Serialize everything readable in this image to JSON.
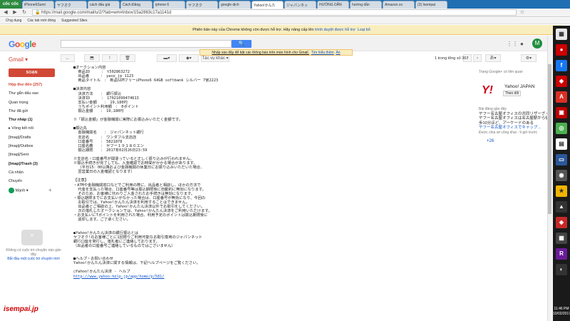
{
  "browser": {
    "logo": "cốc cốc",
    "tabs": [
      "iPhone6Sumi",
      "ヤフオク",
      "cách đấu giá",
      "Cách Đăng",
      "iphone 6",
      "ヤフオク",
      "google dịch",
      "Yahoo!かんた",
      "ジャパンネッ",
      "HƯỚNG DẪN",
      "hướng dẫn",
      "Amazon.co",
      "(3) Isempai"
    ],
    "active_tab": 7,
    "url": "https://mail.google.com/mail/u/2/?tab=wm#inbox/15a2863c17a1141d",
    "bookmarks": [
      "Ứng dụng",
      "Các tab mới đóng",
      "Suggested Sites"
    ]
  },
  "chrome_notice": {
    "text": "Phiên bản này của Chrome không còn được hỗ trợ. Hãy nâng cấp lên ",
    "link": "trình duyệt được hỗ trợ",
    "dismiss": "Loại bỏ"
  },
  "gmail": {
    "logo": "Google",
    "label": "Gmail ▾",
    "avatar": "M",
    "notice_text": "Nhấp vào đây để bật các thông báo trên màn hình cho Gmail.",
    "notice_learn": "Tìm hiểu thêm",
    "notice_hide": "Ẩn",
    "more_label": "Tác vụ khác ▾",
    "page_count": "1 trong tổng số 367",
    "compose": "SOẠN",
    "sidebar": [
      {
        "label": "Hộp thư đến (257)",
        "style": "red"
      },
      {
        "label": "Thư gắn dấu sao",
        "style": ""
      },
      {
        "label": "Quan trọng",
        "style": ""
      },
      {
        "label": "Thư đã gửi",
        "style": ""
      },
      {
        "label": "Thư nháp (1)",
        "style": "bold"
      },
      {
        "label": "▸ Vòng kết nối",
        "style": ""
      },
      {
        "label": "[Imap]/Drafts",
        "style": ""
      },
      {
        "label": "[Imap]/Outbox",
        "style": ""
      },
      {
        "label": "[Imap]/Sent",
        "style": ""
      },
      {
        "label": "[Imap]/Trash (3)",
        "style": "bold"
      },
      {
        "label": "Cá nhân",
        "style": ""
      },
      {
        "label": "Chuyến",
        "style": ""
      }
    ],
    "user": "Mạnh ▾",
    "hangout_text": "Không có cuộc trò chuyện nào gần đây",
    "hangout_start": "Bắt đầu một cuộc trò chuyện mới"
  },
  "mail_body": [
    "■オークション内容",
    "  商品ID　　　：　t502863272",
    "  出品者　　　：　yase_jp_1123",
    "  商品タイトル　：　新品SIMフリーiPhone6 64GB softbank シルバー 7宮2223",
    "",
    "■決済内容",
    "  決済方法　　：　銀行振込",
    "  決済ID　　　：　17021099474613",
    "  支払い金額　　：　19,180円",
    "  うちポイント利用額　：　0ポイント",
    "  振込金額　　：　19,180円",
    "",
    "※「振込金額」が金融機関に実際にお振込みいただく金額です。",
    "",
    "■振込先",
    "  金融機関名　　：　ジャパンネット銀行",
    "  支店名　　　：　ワンダフル支店店",
    "  口座番号　　：　5821878",
    "  口座名義　　：　ヤフー１９１８０エン",
    "  振込期限　　：　2017年02月26日23:59",
    "",
    "※支店名・口座番号が間違っていると正しく振り込みが行われません。",
    "※振込手続きが完了しても、入金確認でお時間がかかる場合があります。",
    "  （平日15：00以降および金融機関の休業日にお振り込みいただいた場合、",
    "  翌営業日の入金確認となります）",
    "",
    "【注意】",
    "・ATMや金融機関窓口などでご利用の際に、出品者と相談し、ほかの方法で",
    "  代金を支払った場合、口座番号等は振込期限後に自動的に無効になります。",
    "  そのため、お客様に代わりご入金されたお手続きは無効になります。",
    "・振込期限までにお支払いがなかった場合は、口座番号が無効になり、今回の",
    "  お取引では、Yahoo!かんたん決済を利用することはできません。",
    "  出品者とご相談の上、Yahoo!かんたん決済以外でお取引をしてください。",
    "  次の落札したオークションでは、Yahoo!かんたん決済をご利用いただけます。",
    "・お支払いにTポイントを利用された場合、利用予定のポイントは振込期限後に",
    "  返却します。ご了承ください。",
    "",
    "",
    "●Yahoo!かんたん決済の銀行振込とは",
    "ヤフオク!のお客様ごとに1回限りご利用可能なお取引専用のジャパンネット",
    "銀行口座を発行し、落札者にご連絡しております。",
    "（出品者の口座番号ご連絡しているものではございません）",
    "",
    "",
    "■ヘルプ・お問い合わせ",
    "Yahoo!かんたん決済に関する情報は、下記ヘルプページをご覧ください。",
    "",
    "○Yahoo!かんたん決済 - ヘルプ"
  ],
  "help_link": "http://www.yahoo-help.jp/app/home/p/581/",
  "right_panel": {
    "title": "Trang Google+ có liên quan",
    "name": "Yahoo! JAPAN",
    "follow": "Theo dõi",
    "post_label": "Bài đăng gần đây",
    "post_text": "ヤフー名古屋オフィスの共同リザーブ・ヤフー名古屋オフィスは名古屋駅から徒歩10分ほど、アーケードのある",
    "post_link": "ヤフー名古屋オフィスでキャップ…",
    "post_meta": "Được chia sẻ công khai - 9 giờ trước",
    "plus": "+26"
  },
  "watermark": "isempai.jp",
  "taskbar": {
    "time": "11:46 PM",
    "date": "10/02/2017"
  }
}
